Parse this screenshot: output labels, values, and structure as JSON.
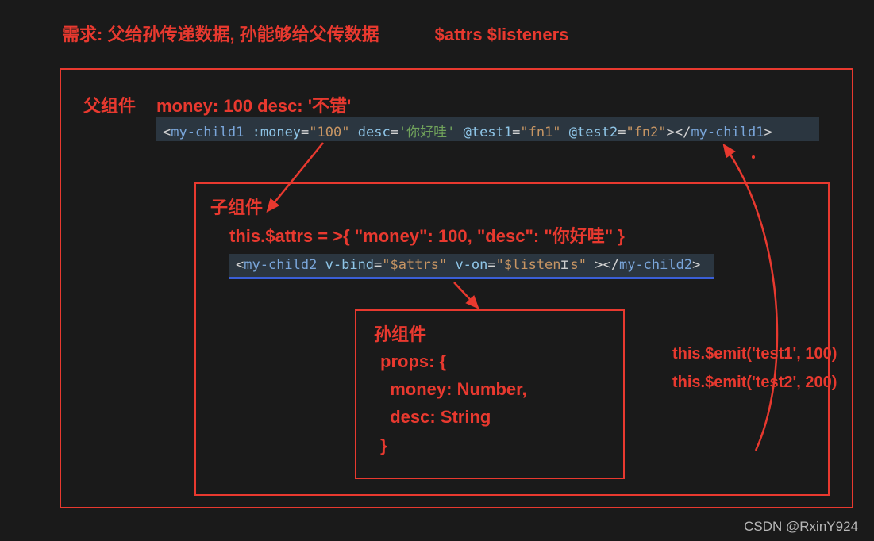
{
  "header": {
    "requirement": "需求: 父给孙传递数据, 孙能够给父传数据",
    "tags": "$attrs  $listeners"
  },
  "parent": {
    "label": "父组件",
    "data": "money: 100   desc: '不错'",
    "code": {
      "open_tag": "my-child1",
      "attr1_name": ":money",
      "attr1_val": "\"100\"",
      "attr2_name": "desc",
      "attr2_val": "'你好哇'",
      "attr3_name": "@test1",
      "attr3_val": "\"fn1\"",
      "attr4_name": "@test2",
      "attr4_val": "\"fn2\"",
      "close_tag": "my-child1"
    }
  },
  "child": {
    "label": "子组件",
    "attrs_line": "this.$attrs = >{ \"money\": 100, \"desc\": \"你好哇\" }",
    "code": {
      "open_tag": "my-child2",
      "attr1_name": "v-bind",
      "attr1_val": "\"$attrs\"",
      "attr2_name": "v-on",
      "attr2_val_pre": "\"$listen",
      "attr2_val_post": "s\"",
      "close_tag": "my-child2"
    }
  },
  "grandchild": {
    "label": "孙组件",
    "props": "props: {\n  money: Number,\n  desc: String\n}"
  },
  "emits": {
    "line1": "this.$emit('test1', 100)",
    "line2": "this.$emit('test2', 200)"
  },
  "watermark": "CSDN @RxinY924"
}
